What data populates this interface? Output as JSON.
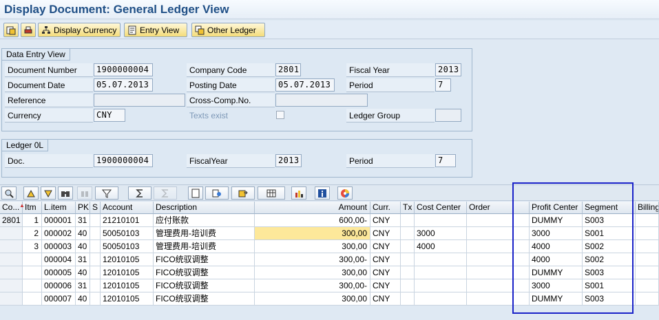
{
  "title": "Display Document: General Ledger View",
  "toolbar": {
    "display_currency": "Display Currency",
    "entry_view": "Entry View",
    "other_ledger": "Other Ledger"
  },
  "entry_view": {
    "group_title": "Data Entry View",
    "doc_number_label": "Document Number",
    "doc_number": "1900000004",
    "company_code_label": "Company Code",
    "company_code": "2801",
    "fiscal_year_label": "Fiscal Year",
    "fiscal_year": "2013",
    "doc_date_label": "Document Date",
    "doc_date": "05.07.2013",
    "posting_date_label": "Posting Date",
    "posting_date": "05.07.2013",
    "period_label": "Period",
    "period": "7",
    "reference_label": "Reference",
    "reference": "",
    "cross_comp_label": "Cross-Comp.No.",
    "cross_comp": "",
    "currency_label": "Currency",
    "currency": "CNY",
    "texts_exist_label": "Texts exist",
    "ledger_group_label": "Ledger Group",
    "ledger_group": ""
  },
  "ledger": {
    "group_title": "Ledger 0L",
    "doc_label": "Doc.",
    "doc": "1900000004",
    "fiscal_year_label": "FiscalYear",
    "fiscal_year": "2013",
    "period_label": "Period",
    "period": "7"
  },
  "grid": {
    "headers": {
      "co": "Co...",
      "itm": "Itm",
      "litem": "L.item",
      "pk": "PK",
      "s": "S",
      "account": "Account",
      "description": "Description",
      "amount": "Amount",
      "curr": "Curr.",
      "tx": "Tx",
      "cost_center": "Cost Center",
      "order": "Order",
      "profit_center": "Profit Center",
      "segment": "Segment",
      "billing": "Billing"
    },
    "rows": [
      {
        "co": "2801",
        "itm": "1",
        "litem": "000001",
        "pk": "31",
        "account": "21210101",
        "description": "应付账款",
        "amount": "600,00-",
        "curr": "CNY",
        "cost_center": "",
        "profit_center": "DUMMY",
        "segment": "S003"
      },
      {
        "co": "",
        "itm": "2",
        "litem": "000002",
        "pk": "40",
        "account": "50050103",
        "description": "管理费用-培训费",
        "amount": "300,00",
        "curr": "CNY",
        "cost_center": "3000",
        "profit_center": "3000",
        "segment": "S001"
      },
      {
        "co": "",
        "itm": "3",
        "litem": "000003",
        "pk": "40",
        "account": "50050103",
        "description": "管理费用-培训费",
        "amount": "300,00",
        "curr": "CNY",
        "cost_center": "4000",
        "profit_center": "4000",
        "segment": "S002"
      },
      {
        "co": "",
        "itm": "",
        "litem": "000004",
        "pk": "31",
        "account": "12010105",
        "description": "FICO统驭调整",
        "amount": "300,00-",
        "curr": "CNY",
        "cost_center": "",
        "profit_center": "4000",
        "segment": "S002"
      },
      {
        "co": "",
        "itm": "",
        "litem": "000005",
        "pk": "40",
        "account": "12010105",
        "description": "FICO统驭调整",
        "amount": "300,00",
        "curr": "CNY",
        "cost_center": "",
        "profit_center": "DUMMY",
        "segment": "S003"
      },
      {
        "co": "",
        "itm": "",
        "litem": "000006",
        "pk": "31",
        "account": "12010105",
        "description": "FICO统驭调整",
        "amount": "300,00-",
        "curr": "CNY",
        "cost_center": "",
        "profit_center": "3000",
        "segment": "S001"
      },
      {
        "co": "",
        "itm": "",
        "litem": "000007",
        "pk": "40",
        "account": "12010105",
        "description": "FICO统驭调整",
        "amount": "300,00",
        "curr": "CNY",
        "cost_center": "",
        "profit_center": "DUMMY",
        "segment": "S003"
      }
    ]
  },
  "colors": {
    "title": "#1f4f86",
    "highlight_box": "#1a22c8",
    "selected_cell": "#fde89a"
  }
}
